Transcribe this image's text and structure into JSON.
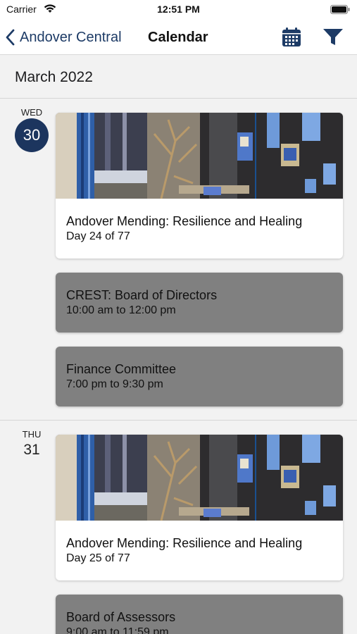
{
  "status_bar": {
    "carrier": "Carrier",
    "time": "12:51 PM"
  },
  "nav": {
    "back_label": "Andover Central",
    "title": "Calendar"
  },
  "month": {
    "label": "March 2022"
  },
  "days": [
    {
      "weekday": "WED",
      "day": "30",
      "events": [
        {
          "title": "Andover Mending: Resilience and Healing",
          "subtitle": "Day 24 of 77"
        },
        {
          "title": "CREST: Board of Directors",
          "subtitle": "10:00 am to 12:00 pm"
        },
        {
          "title": "Finance Committee",
          "subtitle": "7:00 pm to 9:30 pm"
        }
      ]
    },
    {
      "weekday": "THU",
      "day": "31",
      "events": [
        {
          "title": "Andover Mending: Resilience and Healing",
          "subtitle": "Day 25 of 77"
        },
        {
          "title": "Board of Assessors",
          "subtitle": "9:00 am to 11:59 pm"
        }
      ]
    }
  ],
  "colors": {
    "accent": "#1d3b66",
    "selected_day": "#1c355e",
    "grey_card": "#808080",
    "background": "#f2f2f2"
  },
  "icons": [
    "wifi-icon",
    "battery-icon",
    "chevron-left-icon",
    "calendar-icon",
    "filter-icon"
  ]
}
